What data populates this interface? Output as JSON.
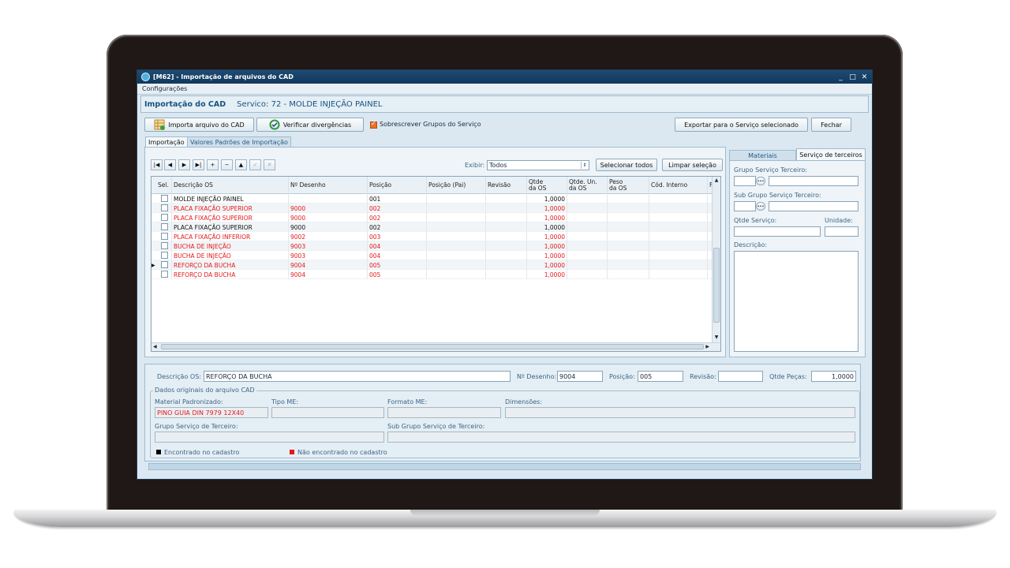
{
  "window": {
    "title": "[M62] - Importação de arquivos do CAD",
    "controls": {
      "minimize": "_",
      "maximize": "□",
      "close": "✕"
    }
  },
  "menu": {
    "items": [
      "Configurações"
    ]
  },
  "header": {
    "title": "Importação do CAD",
    "service_label": "Servico: 72 - MOLDE INJEÇÃO PAINEL"
  },
  "toolbar": {
    "import_button": "Importa arquivo do CAD",
    "verify_button": "Verificar divergências",
    "overwrite_checkbox": "Sobrescrever Grupos do Serviço",
    "overwrite_checked": true,
    "export_button": "Exportar para o Serviço selecionado",
    "close_button": "Fechar"
  },
  "tabs": {
    "main": [
      "Importação",
      "Valores Padrões de Importação"
    ],
    "main_active": 0,
    "side": [
      "Materiais",
      "Serviço de terceiros"
    ],
    "side_active": 1
  },
  "grid_controls": {
    "nav_buttons": [
      "|◀",
      "◀",
      "▶",
      "▶|",
      "+",
      "−",
      "▲",
      "✓",
      "✕"
    ],
    "filter_label": "Exibir:",
    "filter_value": "Todos",
    "select_all_button": "Selecionar todos",
    "clear_selection_button": "Limpar seleção"
  },
  "grid": {
    "columns": [
      "Sel.",
      "Descrição OS",
      "Nº Desenho",
      "Posição",
      "Posição (Pai)",
      "Revisão",
      "Qtde\nda OS",
      "Qtde. Un.\nda OS",
      "Peso\nda OS",
      "Cód. Interno",
      "F"
    ],
    "rows": [
      {
        "descricao": "MOLDE INJEÇÃO PAINEL",
        "desenho": "",
        "posicao": "001",
        "posicao_pai": "",
        "revisao": "",
        "qtde": "1,0000",
        "status": "found"
      },
      {
        "descricao": "PLACA FIXAÇÃO SUPERIOR",
        "desenho": "9000",
        "posicao": "002",
        "posicao_pai": "",
        "revisao": "",
        "qtde": "1,0000",
        "status": "not_found"
      },
      {
        "descricao": "PLACA FIXAÇÃO SUPERIOR",
        "desenho": "9000",
        "posicao": "002",
        "posicao_pai": "",
        "revisao": "",
        "qtde": "1,0000",
        "status": "not_found"
      },
      {
        "descricao": "PLACA FIXAÇÃO SUPERIOR",
        "desenho": "9000",
        "posicao": "002",
        "posicao_pai": "",
        "revisao": "",
        "qtde": "1,0000",
        "status": "found"
      },
      {
        "descricao": "PLACA FIXAÇÃO INFERIOR",
        "desenho": "9002",
        "posicao": "003",
        "posicao_pai": "",
        "revisao": "",
        "qtde": "1,0000",
        "status": "not_found"
      },
      {
        "descricao": "BUCHA DE INJEÇÃO",
        "desenho": "9003",
        "posicao": "004",
        "posicao_pai": "",
        "revisao": "",
        "qtde": "1,0000",
        "status": "not_found"
      },
      {
        "descricao": "BUCHA DE INJEÇÃO",
        "desenho": "9003",
        "posicao": "004",
        "posicao_pai": "",
        "revisao": "",
        "qtde": "1,0000",
        "status": "not_found"
      },
      {
        "descricao": "REFORÇO DA BUCHA",
        "desenho": "9004",
        "posicao": "005",
        "posicao_pai": "",
        "revisao": "",
        "qtde": "1,0000",
        "status": "not_found"
      },
      {
        "descricao": "REFORÇO DA BUCHA",
        "desenho": "9004",
        "posicao": "005",
        "posicao_pai": "",
        "revisao": "",
        "qtde": "1,0000",
        "status": "not_found"
      }
    ],
    "current_row": 7
  },
  "side_panel": {
    "grupo_label": "Grupo Serviço Terceiro:",
    "subgrupo_label": "Sub Grupo Serviço Terceiro:",
    "qtde_label": "Qtde Serviço:",
    "unidade_label": "Unidade:",
    "descricao_label": "Descrição:",
    "lookup_button": "•••"
  },
  "detail": {
    "descricao_label": "Descrição OS:",
    "descricao_value": "REFORÇO DA BUCHA",
    "desenho_label": "Nº Desenho:",
    "desenho_value": "9004",
    "posicao_label": "Posição:",
    "posicao_value": "005",
    "revisao_label": "Revisão:",
    "revisao_value": "",
    "qtde_label": "Qtde Peças:",
    "qtde_value": "1,0000"
  },
  "original_data": {
    "group_title": "Dados originais do arquivo CAD",
    "material_label": "Material Padronizado:",
    "material_value": "PINO GUIA DIN 7979 12X40",
    "tipo_label": "Tipo ME:",
    "formato_label": "Formato ME:",
    "dimensoes_label": "Dimensões:",
    "grupo_label": "Grupo Serviço de Terceiro:",
    "subgrupo_label": "Sub Grupo Serviço de Terceiro:"
  },
  "legend": {
    "found_label": "Encontrado no cadastro",
    "not_found_label": "Não encontrado no cadastro",
    "found_color": "#000000",
    "not_found_color": "#e51919"
  }
}
